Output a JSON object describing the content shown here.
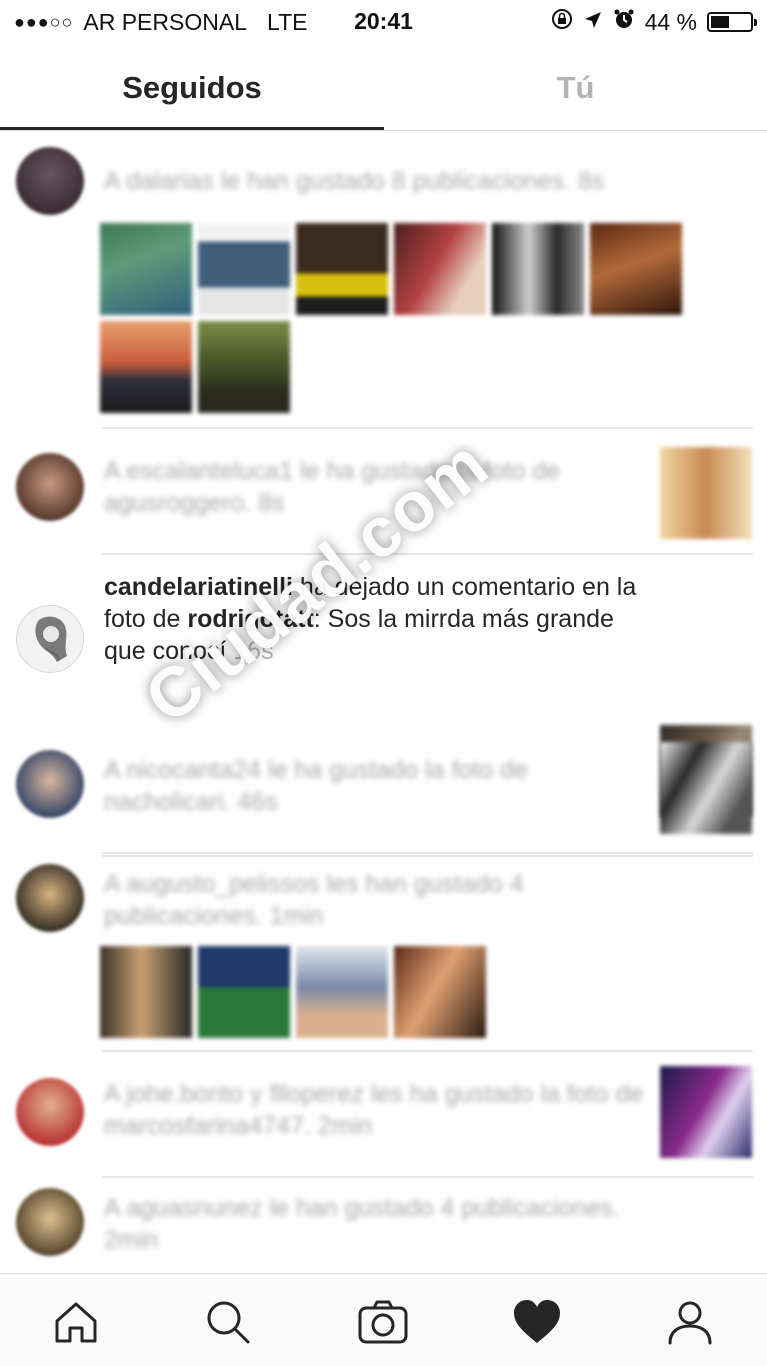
{
  "status_bar": {
    "carrier": "AR PERSONAL",
    "network": "LTE",
    "time": "20:41",
    "battery": "44 %",
    "battery_level": 0.44
  },
  "tabs": [
    {
      "label": "Seguidos",
      "active": true
    },
    {
      "label": "Tú",
      "active": false
    }
  ],
  "feed": {
    "items": [
      {
        "text": "A dalarias le han gustado 8 publicaciones. 8s"
      },
      {
        "text": "A escalanteluca1 le ha gustado la foto de agusroggero. 8s"
      },
      {
        "user": "candelariatinelli",
        "action": " ha dejado un comentario en la foto de ",
        "target": "rodrigotatt",
        "comment": ": Sos la mirrda más grande que conocí",
        "time": " 16s"
      },
      {
        "text": "A nicocanta24 le ha gustado la foto de nacholicari. 46s"
      },
      {
        "text": "A augusto_pelissos les han gustado 4 publicaciones. 1min"
      },
      {
        "text": "A johe.borito y flloperez les ha gustado la foto de marcosfarina4747. 2min"
      },
      {
        "text": "A aguasnunez le han gustado 4 publicaciones. 2min"
      }
    ]
  },
  "watermark": "Ciudad.com",
  "bottom_nav": [
    {
      "icon": "home-icon"
    },
    {
      "icon": "search-icon"
    },
    {
      "icon": "camera-icon"
    },
    {
      "icon": "heart-icon",
      "active": true
    },
    {
      "icon": "profile-icon"
    }
  ]
}
